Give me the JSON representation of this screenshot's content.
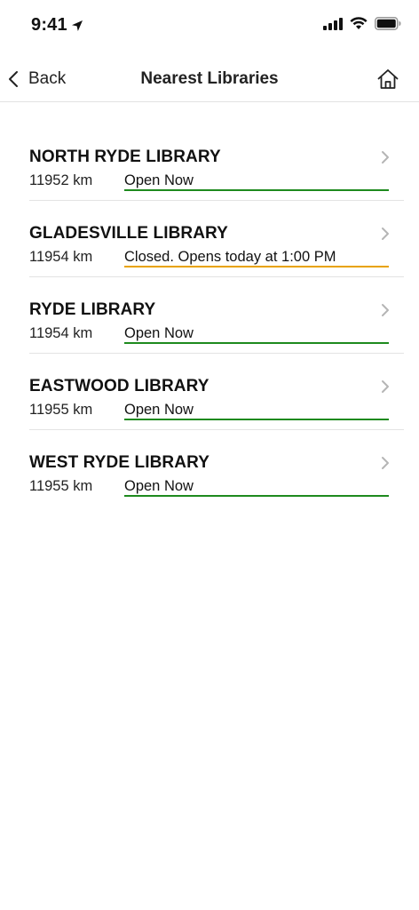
{
  "status_bar": {
    "time": "9:41"
  },
  "nav": {
    "back_label": "Back",
    "title": "Nearest Libraries"
  },
  "colors": {
    "open": "#1e8a1e",
    "closed": "#e8a200"
  },
  "icons": {
    "location": "location-arrow-icon",
    "signal": "cellular-signal-icon",
    "wifi": "wifi-icon",
    "battery": "battery-icon",
    "back": "chevron-left-icon",
    "home": "home-icon",
    "row": "chevron-right-icon"
  },
  "libraries": [
    {
      "name": "NORTH RYDE LIBRARY",
      "distance": "11952 km",
      "status": "Open Now",
      "state": "open"
    },
    {
      "name": "GLADESVILLE LIBRARY",
      "distance": "11954 km",
      "status": "Closed. Opens today at 1:00 PM",
      "state": "closed"
    },
    {
      "name": "RYDE LIBRARY",
      "distance": "11954 km",
      "status": "Open Now",
      "state": "open"
    },
    {
      "name": "EASTWOOD LIBRARY",
      "distance": "11955 km",
      "status": "Open Now",
      "state": "open"
    },
    {
      "name": "WEST RYDE LIBRARY",
      "distance": "11955 km",
      "status": "Open Now",
      "state": "open"
    }
  ]
}
